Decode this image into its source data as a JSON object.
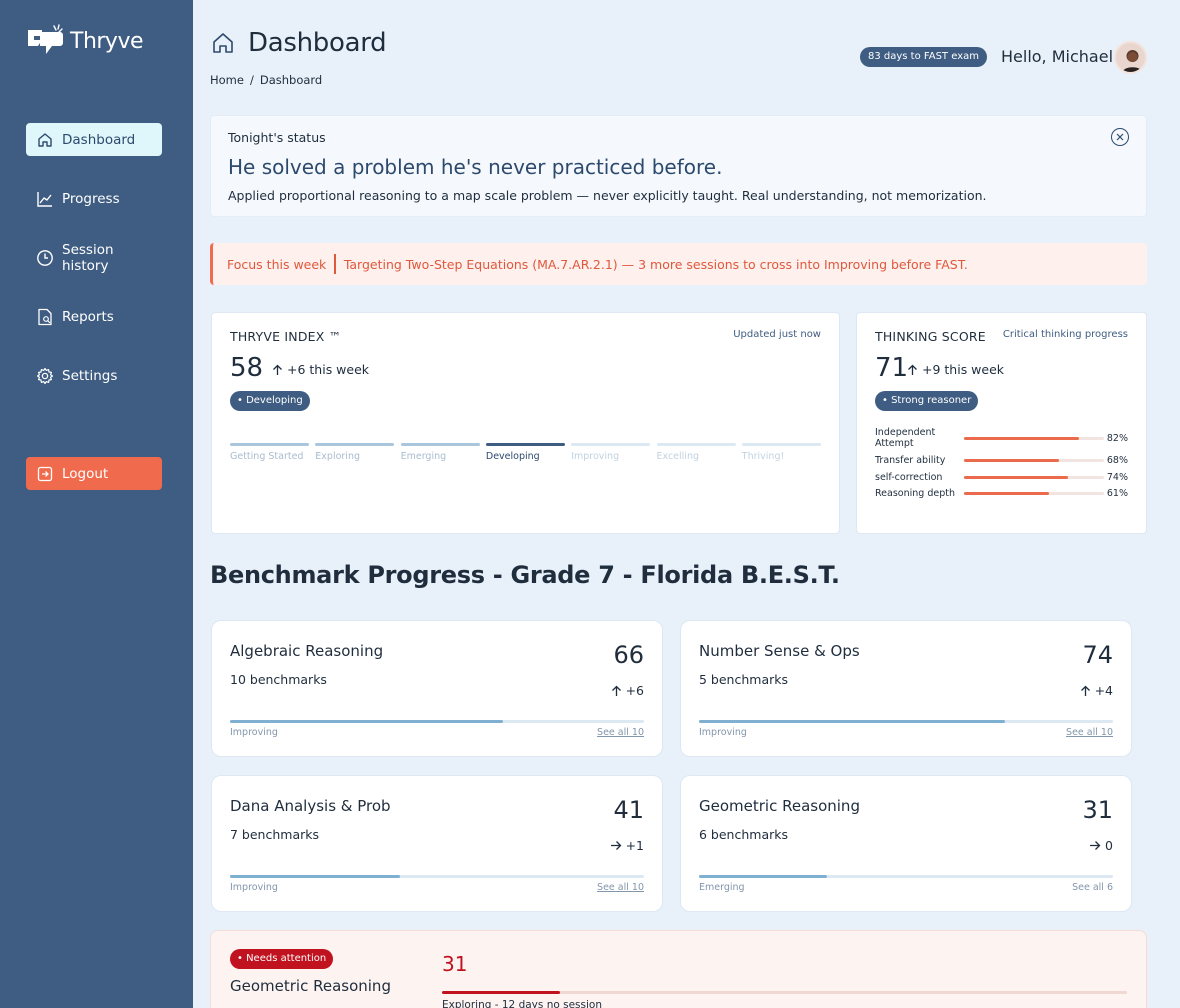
{
  "brand": {
    "name": "Thryve"
  },
  "sidebar": {
    "items": [
      {
        "label": "Dashboard",
        "icon": "home-icon",
        "active": true
      },
      {
        "label": "Progress",
        "icon": "chart-line-icon"
      },
      {
        "label": "Session history",
        "icon": "clock-icon"
      },
      {
        "label": "Reports",
        "icon": "report-icon"
      },
      {
        "label": "Settings",
        "icon": "gear-icon"
      }
    ],
    "logout_label": "Logout"
  },
  "header": {
    "title": "Dashboard",
    "breadcrumb": [
      "Home",
      "/",
      "Dashboard"
    ],
    "exam_badge": "83 days to FAST exam",
    "greeting": "Hello, Michael"
  },
  "status": {
    "label": "Tonight's status",
    "headline": "He solved a problem he's never practiced before.",
    "text": "Applied proportional reasoning to a map scale problem — never explicitly taught. Real understanding, not memorization."
  },
  "focus": {
    "label": "Focus this week",
    "text": "Targeting Two-Step Equations (MA.7.AR.2.1) — 3 more sessions to cross into Improving before FAST."
  },
  "index": {
    "title": "THRYVE INDEX ™",
    "note": "Updated just now",
    "score": "58",
    "delta": "+6 this week",
    "level": "• Developing",
    "stages": [
      "Getting Started",
      "Exploring",
      "Emerging",
      "Developing",
      "Improving",
      "Excelling",
      "Thriving!"
    ],
    "current_stage": 3
  },
  "thinking": {
    "title": "THINKING SCORE",
    "note": "Critical thinking progress",
    "score": "71",
    "delta": "+9 this week",
    "level": "• Strong reasoner",
    "metrics": [
      {
        "label": "Independent Attempt",
        "value": "82%",
        "pct": 82
      },
      {
        "label": "Transfer ability",
        "value": "68%",
        "pct": 68
      },
      {
        "label": "self-correction",
        "value": "74%",
        "pct": 74
      },
      {
        "label": "Reasoning depth",
        "value": "61%",
        "pct": 61
      }
    ]
  },
  "benchmark": {
    "title": "Benchmark Progress - Grade 7 - Florida B.E.S.T.",
    "cards": [
      {
        "name": "Algebraic Reasoning",
        "count": "10 benchmarks",
        "score": "66",
        "delta": "+6",
        "trend": "up",
        "level": "Improving",
        "link": "See all 10"
      },
      {
        "name": "Number Sense & Ops",
        "count": "5 benchmarks",
        "score": "74",
        "delta": "+4",
        "trend": "up",
        "level": "Improving",
        "link": "See all 10"
      },
      {
        "name": "Dana Analysis & Prob",
        "count": "7 benchmarks",
        "score": "41",
        "delta": "+1",
        "trend": "right",
        "level": "Improving",
        "link": "See all 10"
      },
      {
        "name": "Geometric Reasoning",
        "count": "6 benchmarks",
        "score": "31",
        "delta": "0",
        "trend": "right",
        "level": "Emerging",
        "link": "See all 6"
      }
    ]
  },
  "attention": {
    "badge": "• Needs attention",
    "name": "Geometric Reasoning",
    "score": "31",
    "note": "Exploring - 12 days no session"
  },
  "colors": {
    "sidebar": "#3f5d82",
    "accent": "#f06b4e",
    "alert": "#c1121f",
    "background": "#e8f1fa"
  }
}
